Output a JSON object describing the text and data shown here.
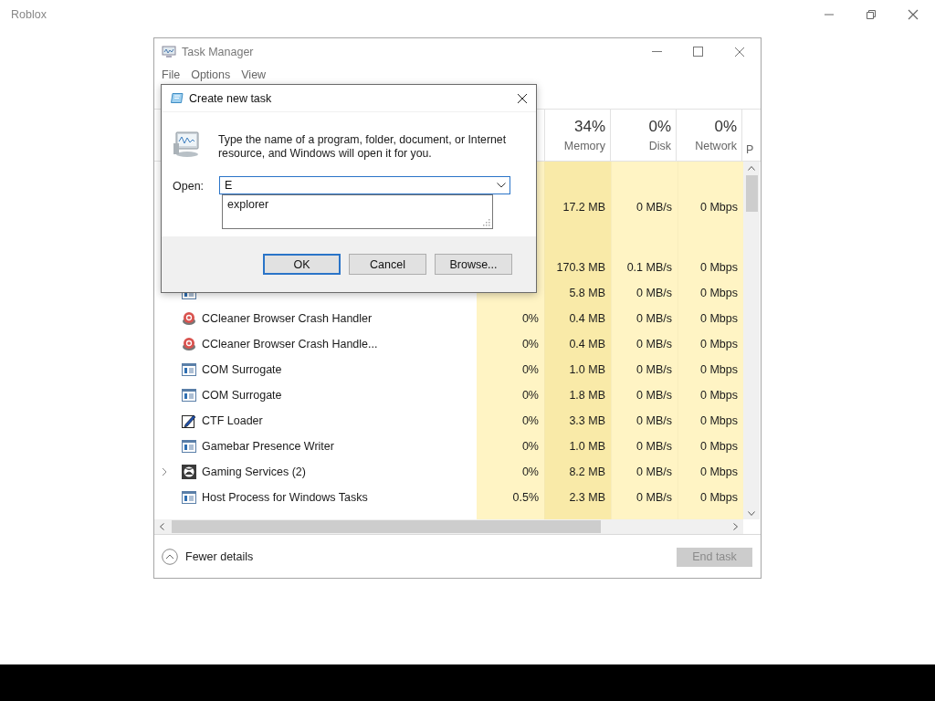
{
  "app": {
    "title": "Roblox"
  },
  "task_manager": {
    "title": "Task Manager",
    "menu": [
      "File",
      "Options",
      "View"
    ],
    "columns": [
      {
        "percent": "34%",
        "label": "Memory"
      },
      {
        "percent": "0%",
        "label": "Disk"
      },
      {
        "percent": "0%",
        "label": "Network"
      },
      {
        "label": "P"
      }
    ],
    "rows": [
      {
        "kind": "hidden",
        "memory": "17.2 MB",
        "disk": "0 MB/s",
        "network": "0 Mbps"
      },
      {
        "kind": "group"
      },
      {
        "kind": "hidden",
        "memory": "170.3 MB",
        "disk": "0.1 MB/s",
        "network": "0 Mbps"
      },
      {
        "kind": "window",
        "memory": "5.8 MB",
        "disk": "0 MB/s",
        "network": "0 Mbps"
      },
      {
        "kind": "ccleaner",
        "name": "CCleaner Browser Crash Handler",
        "cpu": "0%",
        "memory": "0.4 MB",
        "disk": "0 MB/s",
        "network": "0 Mbps"
      },
      {
        "kind": "ccleaner",
        "name": "CCleaner Browser Crash Handle...",
        "cpu": "0%",
        "memory": "0.4 MB",
        "disk": "0 MB/s",
        "network": "0 Mbps"
      },
      {
        "kind": "window",
        "name": "COM Surrogate",
        "cpu": "0%",
        "memory": "1.0 MB",
        "disk": "0 MB/s",
        "network": "0 Mbps"
      },
      {
        "kind": "window",
        "name": "COM Surrogate",
        "cpu": "0%",
        "memory": "1.8 MB",
        "disk": "0 MB/s",
        "network": "0 Mbps"
      },
      {
        "kind": "pen",
        "name": "CTF Loader",
        "cpu": "0%",
        "memory": "3.3 MB",
        "disk": "0 MB/s",
        "network": "0 Mbps"
      },
      {
        "kind": "window",
        "name": "Gamebar Presence Writer",
        "cpu": "0%",
        "memory": "1.0 MB",
        "disk": "0 MB/s",
        "network": "0 Mbps"
      },
      {
        "kind": "xbox",
        "name": "Gaming Services (2)",
        "expandable": true,
        "cpu": "0%",
        "memory": "8.2 MB",
        "disk": "0 MB/s",
        "network": "0 Mbps"
      },
      {
        "kind": "window",
        "name": "Host Process for Windows Tasks",
        "cpu": "0.5%",
        "memory": "2.3 MB",
        "disk": "0 MB/s",
        "network": "0 Mbps"
      }
    ],
    "footer": {
      "toggle": "Fewer details",
      "end_task": {
        "label": "End task",
        "disabled": true
      }
    }
  },
  "dialog": {
    "title": "Create new task",
    "message": "Type the name of a program, folder, document, or Internet resource, and Windows will open it for you.",
    "open_label": "Open:",
    "value": "E",
    "suggestions": [
      "explorer"
    ],
    "buttons": [
      {
        "label": "OK",
        "default": true
      },
      {
        "label": "Cancel",
        "default": false
      },
      {
        "label": "Browse...",
        "default": false
      }
    ]
  }
}
